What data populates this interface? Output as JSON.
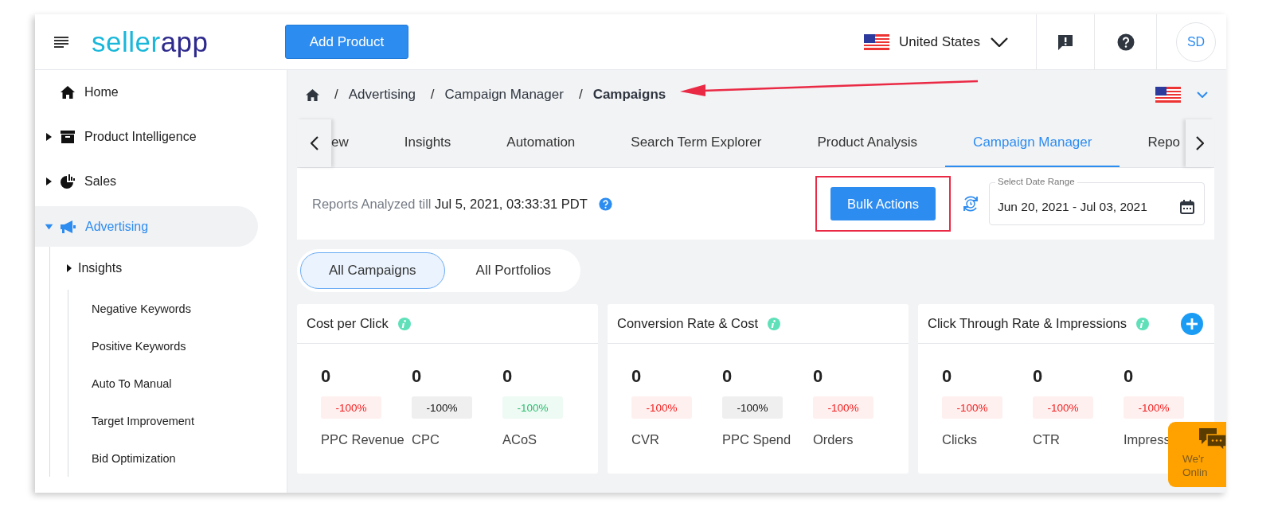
{
  "header": {
    "logo": [
      "seller",
      "app"
    ],
    "add_button": "Add Product",
    "country": "United States",
    "avatar": "SD"
  },
  "sidebar": {
    "items": [
      {
        "label": "Home",
        "selected": false
      },
      {
        "label": "Product Intelligence",
        "selected": false,
        "expanded": false
      },
      {
        "label": "Sales",
        "selected": false,
        "expanded": false
      },
      {
        "label": "Advertising",
        "selected": true,
        "expanded": true,
        "children": [
          {
            "label": "Insights",
            "expanded": false,
            "children": [
              {
                "label": "Negative Keywords"
              },
              {
                "label": "Positive Keywords"
              },
              {
                "label": "Auto To Manual"
              },
              {
                "label": "Target Improvement"
              },
              {
                "label": "Bid Optimization"
              }
            ]
          }
        ]
      }
    ]
  },
  "breadcrumb": [
    {
      "separator": "/",
      "label": "Advertising"
    },
    {
      "separator": "/",
      "label": "Campaign Manager"
    },
    {
      "separator": "/",
      "label": "Campaigns"
    }
  ],
  "tabs": [
    {
      "label": "ew",
      "selected": false
    },
    {
      "label": "Insights",
      "selected": false
    },
    {
      "label": "Automation",
      "selected": false
    },
    {
      "label": "Search Term Explorer",
      "selected": false
    },
    {
      "label": "Product Analysis",
      "selected": false
    },
    {
      "label": "Campaign Manager",
      "selected": true
    },
    {
      "label": "Repo",
      "selected": false
    }
  ],
  "report": {
    "label": "Reports Analyzed till",
    "time": "Jul 5, 2021, 03:33:31 PDT",
    "bulk_button": "Bulk Actions",
    "date_field": {
      "label": "Select Date Range",
      "value": "Jun 20, 2021 - Jul 03, 2021"
    }
  },
  "views": [
    {
      "label": "All Campaigns",
      "selected": true
    },
    {
      "label": "All Portfolios",
      "selected": false
    }
  ],
  "cards": [
    {
      "title": "Cost per Click",
      "metrics": [
        {
          "value": "0",
          "change": "-100%",
          "kind": "down",
          "label": "PPC Revenue"
        },
        {
          "value": "0",
          "change": "-100%",
          "kind": "flat",
          "label": "CPC"
        },
        {
          "value": "0",
          "change": "-100%",
          "kind": "up",
          "label": "ACoS"
        }
      ]
    },
    {
      "title": "Conversion Rate & Cost",
      "metrics": [
        {
          "value": "0",
          "change": "-100%",
          "kind": "down",
          "label": "CVR"
        },
        {
          "value": "0",
          "change": "-100%",
          "kind": "flat",
          "label": "PPC Spend"
        },
        {
          "value": "0",
          "change": "-100%",
          "kind": "down",
          "label": "Orders"
        }
      ]
    },
    {
      "title": "Click Through Rate & Impressions",
      "add": true,
      "metrics": [
        {
          "value": "0",
          "change": "-100%",
          "kind": "down",
          "label": "Clicks"
        },
        {
          "value": "0",
          "change": "-100%",
          "kind": "down",
          "label": "CTR"
        },
        {
          "value": "0",
          "change": "-100%",
          "kind": "down",
          "label": "Impress"
        }
      ]
    }
  ],
  "chat": [
    "We'r",
    "Onlin"
  ]
}
